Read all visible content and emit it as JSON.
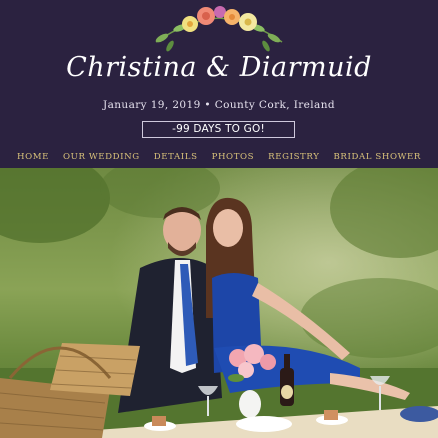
{
  "site": {
    "couple_names": "Christina & Diarmuid",
    "event_details": "January 19, 2019 • County Cork, Ireland",
    "countdown": "-99 DAYS TO GO!"
  },
  "nav": {
    "items": [
      {
        "label": "HOME"
      },
      {
        "label": "OUR WEDDING"
      },
      {
        "label": "DETAILS"
      },
      {
        "label": "PHOTOS"
      },
      {
        "label": "REGISTRY"
      },
      {
        "label": "BRIDAL SHOWER"
      }
    ]
  },
  "colors": {
    "header_background": "#2b2240",
    "nav_text": "#d9c27a",
    "title_text": "#ffffff"
  },
  "hero_photo": {
    "icon": "couple-picnic-photo"
  }
}
